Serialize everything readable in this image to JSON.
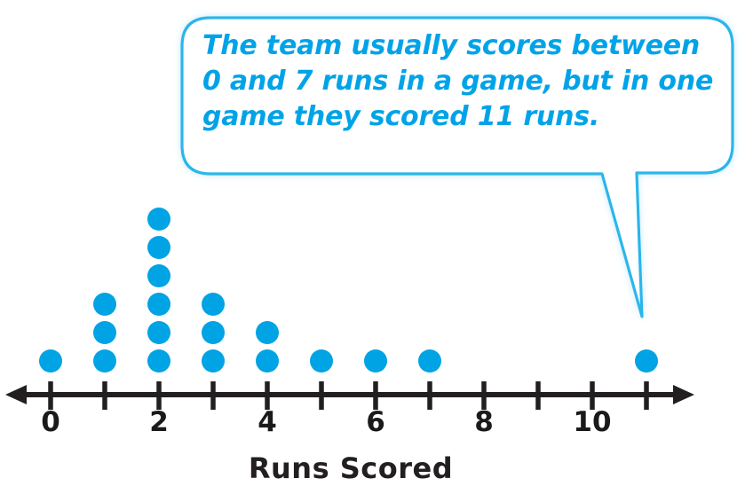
{
  "callout": {
    "text": "The team usually scores between\n0 and 7 runs in a game, but in one\ngame they scored 11 runs.",
    "text_color": "#00a3e8",
    "border_color": "#29b6ea",
    "fill_color": "#ffffff"
  },
  "axis": {
    "title": "Runs Scored",
    "tick_labels": [
      "0",
      "",
      "2",
      "",
      "4",
      "",
      "6",
      "",
      "8",
      "",
      "10",
      ""
    ],
    "visible_labels": [
      "0",
      "2",
      "4",
      "6",
      "8",
      "10"
    ],
    "line_color": "#231f20",
    "label_color": "#1a1a1a"
  },
  "chart_data": {
    "type": "scatter",
    "plot_kind": "dot-plot",
    "title": "",
    "subtitle": "",
    "xlabel": "Runs Scored",
    "ylabel": "",
    "categories": [
      0,
      1,
      2,
      3,
      4,
      5,
      6,
      7,
      8,
      9,
      10,
      11
    ],
    "values": [
      1,
      3,
      6,
      3,
      2,
      1,
      1,
      1,
      0,
      0,
      0,
      1
    ],
    "total_dots": 19,
    "dot_color": "#00a3e4",
    "xlim": [
      0,
      11
    ],
    "x_tick_step": 1,
    "x_labeled_ticks": [
      0,
      2,
      4,
      6,
      8,
      10
    ],
    "grid": false,
    "legend": false,
    "annotations": [
      {
        "text": "The team usually scores between 0 and 7 runs in a game, but in one game they scored 11 runs.",
        "points_to": 11
      }
    ]
  }
}
